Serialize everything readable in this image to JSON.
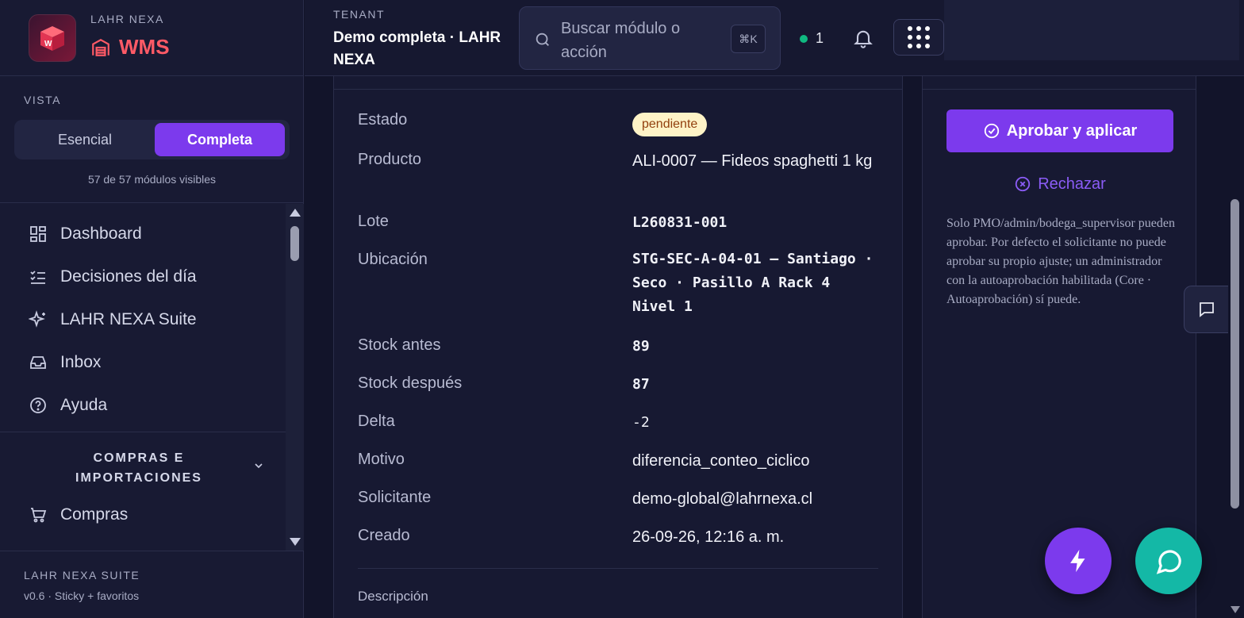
{
  "brand": {
    "overline": "LAHR NEXA",
    "module": "WMS",
    "logo_letter": "W"
  },
  "vista": {
    "label": "VISTA",
    "options": [
      "Esencial",
      "Completa"
    ],
    "selected": "Completa",
    "count_text": "57 de 57 módulos visibles"
  },
  "nav": {
    "items": [
      {
        "label": "Dashboard",
        "icon": "dashboard-icon"
      },
      {
        "label": "Decisiones del día",
        "icon": "checklist-icon"
      },
      {
        "label": "LAHR NEXA Suite",
        "icon": "sparkles-icon"
      },
      {
        "label": "Inbox",
        "icon": "inbox-icon"
      },
      {
        "label": "Ayuda",
        "icon": "help-icon"
      }
    ],
    "group_title": "COMPRAS E IMPORTACIONES",
    "group_items": [
      {
        "label": "Compras",
        "icon": "cart-icon"
      }
    ]
  },
  "suite": {
    "title": "LAHR NEXA SUITE",
    "version": "v0.6 · Sticky + favoritos"
  },
  "header": {
    "tenant_label": "TENANT",
    "tenant_name": "Demo completa · LAHR NEXA",
    "search_placeholder": "Buscar módulo o acción",
    "shortcut": "⌘K",
    "online_count": "1"
  },
  "detail": {
    "fields": [
      {
        "key": "Estado",
        "value": "pendiente"
      },
      {
        "key": "Producto",
        "value": "ALI-0007 — Fideos spaghetti 1 kg"
      },
      {
        "key": "Lote",
        "value": "L260831-001"
      },
      {
        "key": "Ubicación",
        "value": "STG-SEC-A-04-01 — Santiago · Seco · Pasillo A Rack 4 Nivel 1"
      },
      {
        "key": "Stock antes",
        "value": "89"
      },
      {
        "key": "Stock después",
        "value": "87"
      },
      {
        "key": "Delta",
        "value": "-2"
      },
      {
        "key": "Motivo",
        "value": "diferencia_conteo_ciclico"
      },
      {
        "key": "Solicitante",
        "value": "demo-global@lahrnexa.cl"
      },
      {
        "key": "Creado",
        "value": "26-09-26, 12:16 a. m."
      }
    ],
    "description_label": "Descripción"
  },
  "actions": {
    "approve_label": "Aprobar y aplicar",
    "reject_label": "Rechazar",
    "note": "Solo PMO/admin/bodega_supervisor pueden aprobar. Por defecto el solicitante no puede aprobar su propio ajuste; un administrador con la autoaprobación habilitada (Core · Autoaprobación) sí puede."
  },
  "colors": {
    "accent": "#7c3aed",
    "brand_red": "#ff5a66",
    "teal": "#14b8a6",
    "status_pending_bg": "#fef3c7",
    "negative": "#ef4444",
    "online": "#10b981"
  }
}
